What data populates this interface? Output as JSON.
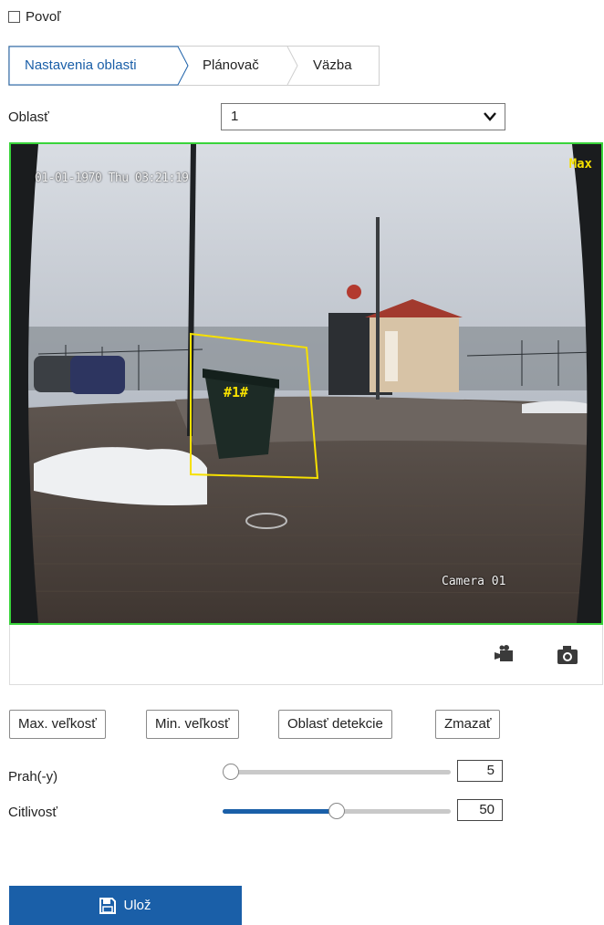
{
  "enable": {
    "label": "Povoľ",
    "checked": false
  },
  "tabs": [
    {
      "label": "Nastavenia oblasti",
      "active": true
    },
    {
      "label": "Plánovač",
      "active": false
    },
    {
      "label": "Väzba",
      "active": false
    }
  ],
  "area": {
    "label": "Oblasť",
    "selected": "1"
  },
  "video": {
    "osd_datetime": "01-01-1970 Thu 03:21:19",
    "osd_level": "Max",
    "osd_camera": "Camera 01",
    "region_label": "#1#",
    "region_color": "#f6e000",
    "border_color": "#39d43a"
  },
  "video_toolbar": {
    "icons": [
      "record-icon",
      "snapshot-icon"
    ]
  },
  "buttons": {
    "max_size": "Max. veľkosť",
    "min_size": "Min. veľkosť",
    "detection_area": "Oblasť detekcie",
    "clear": "Zmazať"
  },
  "threshold": {
    "label": "Prah(-y)",
    "value": "5",
    "level": 0.0
  },
  "sensitivity": {
    "label": "Citlivosť",
    "value": "50",
    "level": 0.5
  },
  "save": {
    "label": "Ulož",
    "color": "#1a5fa8"
  }
}
